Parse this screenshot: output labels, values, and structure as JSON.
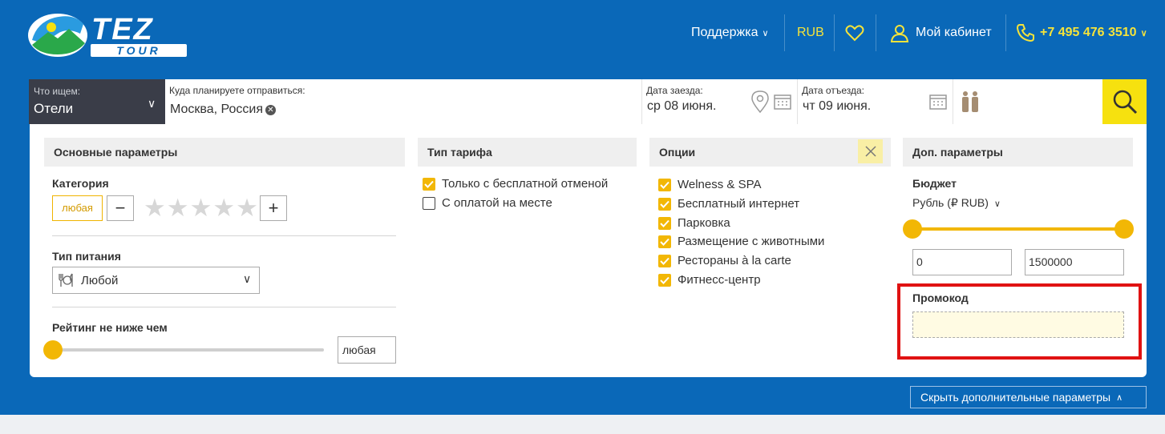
{
  "header": {
    "logo": {
      "title": "TEZ",
      "subtitle": "TOUR"
    },
    "nav": {
      "support": "Поддержка",
      "currency": "RUB",
      "cabinet": "Мой кабинет",
      "phone": "+7 495 476 3510"
    }
  },
  "search": {
    "what_label": "Что ищем:",
    "what_value": "Отели",
    "dest_label": "Куда планируете отправиться:",
    "dest_value": "Москва, Россия",
    "checkin_label": "Дата заезда:",
    "checkin_value": "ср 08 июня.",
    "checkout_label": "Дата отъезда:",
    "checkout_value": "чт 09 июня."
  },
  "panel": {
    "main": {
      "title": "Основные параметры",
      "category_label": "Категория",
      "category_value": "любая",
      "stars_glyphs": "★★★★★",
      "stars_selected": 0,
      "food_label": "Тип питания",
      "food_value": "Любой",
      "rating_label": "Рейтинг не ниже чем",
      "rating_value": "любая",
      "rating_slider": 0
    },
    "tariff": {
      "title": "Тип тарифа",
      "options": [
        {
          "label": "Только с бесплатной отменой",
          "checked": true
        },
        {
          "label": "С оплатой на месте",
          "checked": false
        }
      ]
    },
    "options": {
      "title": "Опции",
      "items": [
        {
          "label": "Welness & SPA",
          "checked": true
        },
        {
          "label": "Бесплатный интернет",
          "checked": true
        },
        {
          "label": "Парковка",
          "checked": true
        },
        {
          "label": "Размещение с животными",
          "checked": true
        },
        {
          "label": "Рестораны à la carte",
          "checked": true
        },
        {
          "label": "Фитнесс-центр",
          "checked": true
        }
      ]
    },
    "extra": {
      "title": "Доп. параметры",
      "budget_label": "Бюджет",
      "budget_currency": "Рубль (₽ RUB)",
      "budget_min": "0",
      "budget_max": "1500000",
      "promo_label": "Промокод",
      "promo_value": ""
    }
  },
  "hide_button": "Скрыть дополнительные параметры",
  "colors": {
    "brand_blue": "#0a68b8",
    "accent_yellow": "#f2b705",
    "highlight_red": "#e01212"
  }
}
